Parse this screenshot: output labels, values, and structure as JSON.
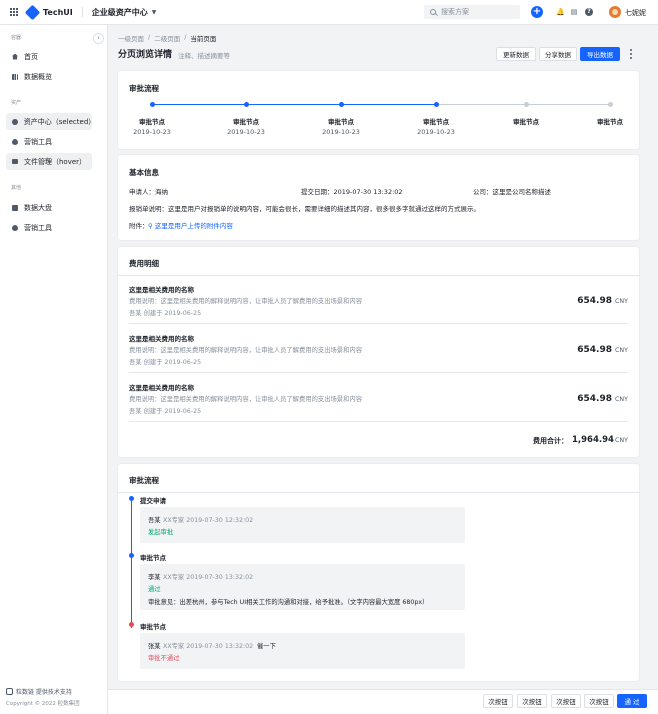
{
  "topbar": {
    "logo_text": "TechUI",
    "app_name": "企业级资产中心",
    "search_placeholder": "搜索方案",
    "user_name": "七妮妮"
  },
  "sidebar": {
    "groups": [
      "容器",
      "资产",
      "其他"
    ],
    "items": [
      {
        "label": "首页",
        "icon": "home-icon"
      },
      {
        "label": "数据概览",
        "icon": "chart-icon"
      },
      {
        "label": "资产中心（selected）",
        "icon": "disk-icon"
      },
      {
        "label": "营销工具",
        "icon": "fire-icon"
      },
      {
        "label": "文件管理（hover）",
        "icon": "folder-icon"
      },
      {
        "label": "数据大盘",
        "icon": "screen-icon"
      },
      {
        "label": "营销工具",
        "icon": "fire-icon"
      }
    ],
    "footer_brand": "粒数链 提供技术支持",
    "copyright": "Copyright © 2022 粒数集团"
  },
  "header": {
    "breadcrumb": [
      "一级页面",
      "/",
      "二级页面",
      "/",
      "当前页面"
    ],
    "title": "分页浏览详情",
    "desc": "注释、描述摘要等",
    "buttons": {
      "update": "更新数据",
      "share": "分享数据",
      "export": "导出数据"
    }
  },
  "approval_steps": {
    "title": "审批流程",
    "steps": [
      {
        "label": "审批节点",
        "date": "2019-10-23",
        "done": true
      },
      {
        "label": "审批节点",
        "date": "2019-10-23",
        "done": true
      },
      {
        "label": "审批节点",
        "date": "2019-10-23",
        "done": true
      },
      {
        "label": "审批节点",
        "date": "2019-10-23",
        "done": true
      },
      {
        "label": "审批节点",
        "date": "",
        "done": false
      },
      {
        "label": "审批节点",
        "date": "",
        "done": false
      }
    ]
  },
  "basic_info": {
    "title": "基本信息",
    "applicant": "申请人：海纳",
    "submit_date": "提交日期：2019-07-30 13:32:02",
    "company": "公司：这里是公司名称描述",
    "note": "报销单说明：这里是用户对报销单的说明内容，可能会很长，需要详细的描述其内容，很多很多字就通过这样的方式展示。",
    "attachment_label": "附件：",
    "attachment_link": "这里是用户上传的附件内容"
  },
  "cost": {
    "title": "费用明细",
    "items": [
      {
        "name": "这里是相关费用的名称",
        "desc": "费用说明：这里是相关费用的解释说明内容，让审批人员了解费用的支出场景和内容",
        "meta": "吾某 创建于 2019-06-25",
        "amount": "654.98",
        "currency": "CNY"
      },
      {
        "name": "这里是相关费用的名称",
        "desc": "费用说明：这里是相关费用的解释说明内容，让审批人员了解费用的支出场景和内容",
        "meta": "吾某 创建于 2019-06-25",
        "amount": "654.98",
        "currency": "CNY"
      },
      {
        "name": "这里是相关费用的名称",
        "desc": "费用说明：这里是相关费用的解释说明内容，让审批人员了解费用的支出场景和内容",
        "meta": "吾某 创建于 2019-06-25",
        "amount": "654.98",
        "currency": "CNY"
      }
    ],
    "total_label": "费用合计：",
    "total_amount": "1,964.94",
    "total_currency": "CNY"
  },
  "timeline": {
    "title": "审批流程",
    "nodes": [
      {
        "title": "提交申请",
        "person": "吾某",
        "meta": "XX专家  2019-07-30 12:32:02",
        "status": "发起审批",
        "status_color": "#00a870",
        "comment": "",
        "action": ""
      },
      {
        "title": "审批节点",
        "person": "李某",
        "meta": "XX专家  2019-07-30 13:32:02",
        "status": "通过",
        "status_color": "#00a870",
        "comment": "审批意见：出差杭州，参与Tech UI相关工作的沟通和对接，给予批准。（文字内容最大宽度 680px）",
        "action": ""
      },
      {
        "title": "审批节点",
        "person": "张某",
        "meta": "XX专家  2019-07-30 13:32:02",
        "status": "审批不通过",
        "status_color": "#e34d59",
        "comment": "",
        "action": "催一下"
      }
    ]
  },
  "footer_buttons": [
    "次按钮",
    "次按钮",
    "次按钮",
    "次按钮",
    "通 过"
  ],
  "colors": {
    "primary": "#1664ff",
    "success": "#00a870",
    "danger": "#e34d59",
    "pending": "#c9cdd4"
  }
}
